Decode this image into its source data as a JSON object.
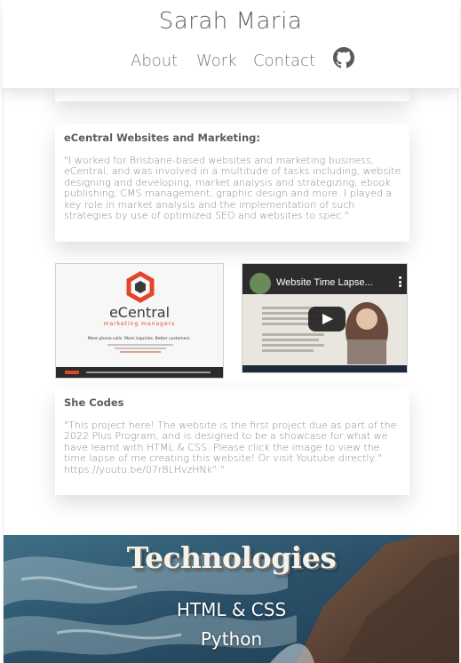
{
  "header": {
    "site_title": "Sarah Maria",
    "nav": {
      "about": "About",
      "work": "Work",
      "contact": "Contact",
      "github_icon": "github-icon"
    }
  },
  "projects": [
    {
      "title": "eCentral Websites and Marketing:",
      "description": "\"I worked for Brisbane-based websites and marketing business, eCentral, and was involved in a multitude of tasks including, website designing and developing, market analysis and strategizing, ebook publishing, CMS management, graphic design and more. I played a key role in market analysis and the implementation of such strategies by use of optimized SEO and websites to spec.\""
    },
    {
      "title": "She Codes",
      "description": "\"This project here! The website is the first project due as part of the 2022 Plus Program, and is designed to be a showcase for what we have learnt with HTML & CSS. Please click the image to view the time lapse of me creating this website! Or visit Youtube directly:\" https://youtu.be/07rBLHvzHNk\" \""
    }
  ],
  "thumbnails": {
    "ecentral": {
      "brand": "eCentral",
      "tagline": "marketing managers",
      "headline": "More phone calls. More inquiries. Better customers."
    },
    "video": {
      "title": "Website Time Lapse...",
      "play_icon": "play-icon"
    }
  },
  "technologies": {
    "heading": "Technologies",
    "items": [
      "HTML & CSS",
      "Python"
    ]
  },
  "colors": {
    "ecentral_orange": "#e2462a",
    "youtube_red": "#222222",
    "ocean_blue": "#2d5a7a"
  }
}
